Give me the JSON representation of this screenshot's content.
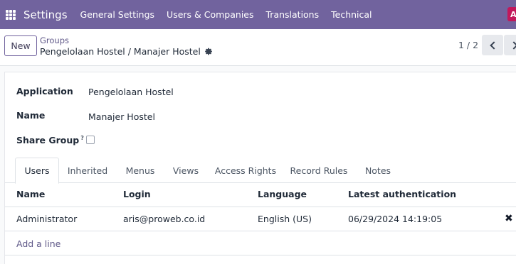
{
  "navbar": {
    "app_title": "Settings",
    "menu": [
      "General Settings",
      "Users & Companies",
      "Translations",
      "Technical"
    ],
    "avatar_letter": "A",
    "accent_color": "#71639e"
  },
  "control": {
    "new_label": "New",
    "breadcrumb_parent": "Groups",
    "breadcrumb_current": "Pengelolaan Hostel / Manajer Hostel",
    "pager": "1 / 2"
  },
  "form": {
    "application_label": "Application",
    "application_value": "Pengelolaan Hostel",
    "name_label": "Name",
    "name_value": "Manajer Hostel",
    "share_group_label": "Share Group",
    "share_group_help": "?",
    "share_group_checked": false
  },
  "tabs": [
    "Users",
    "Inherited",
    "Menus",
    "Views",
    "Access Rights",
    "Record Rules",
    "Notes"
  ],
  "active_tab": "Users",
  "users_table": {
    "columns": [
      "Name",
      "Login",
      "Language",
      "Latest authentication"
    ],
    "rows": [
      [
        "Administrator",
        "aris@proweb.co.id",
        "English (US)",
        "06/29/2024 14:19:05"
      ]
    ],
    "add_line": "Add a line"
  }
}
